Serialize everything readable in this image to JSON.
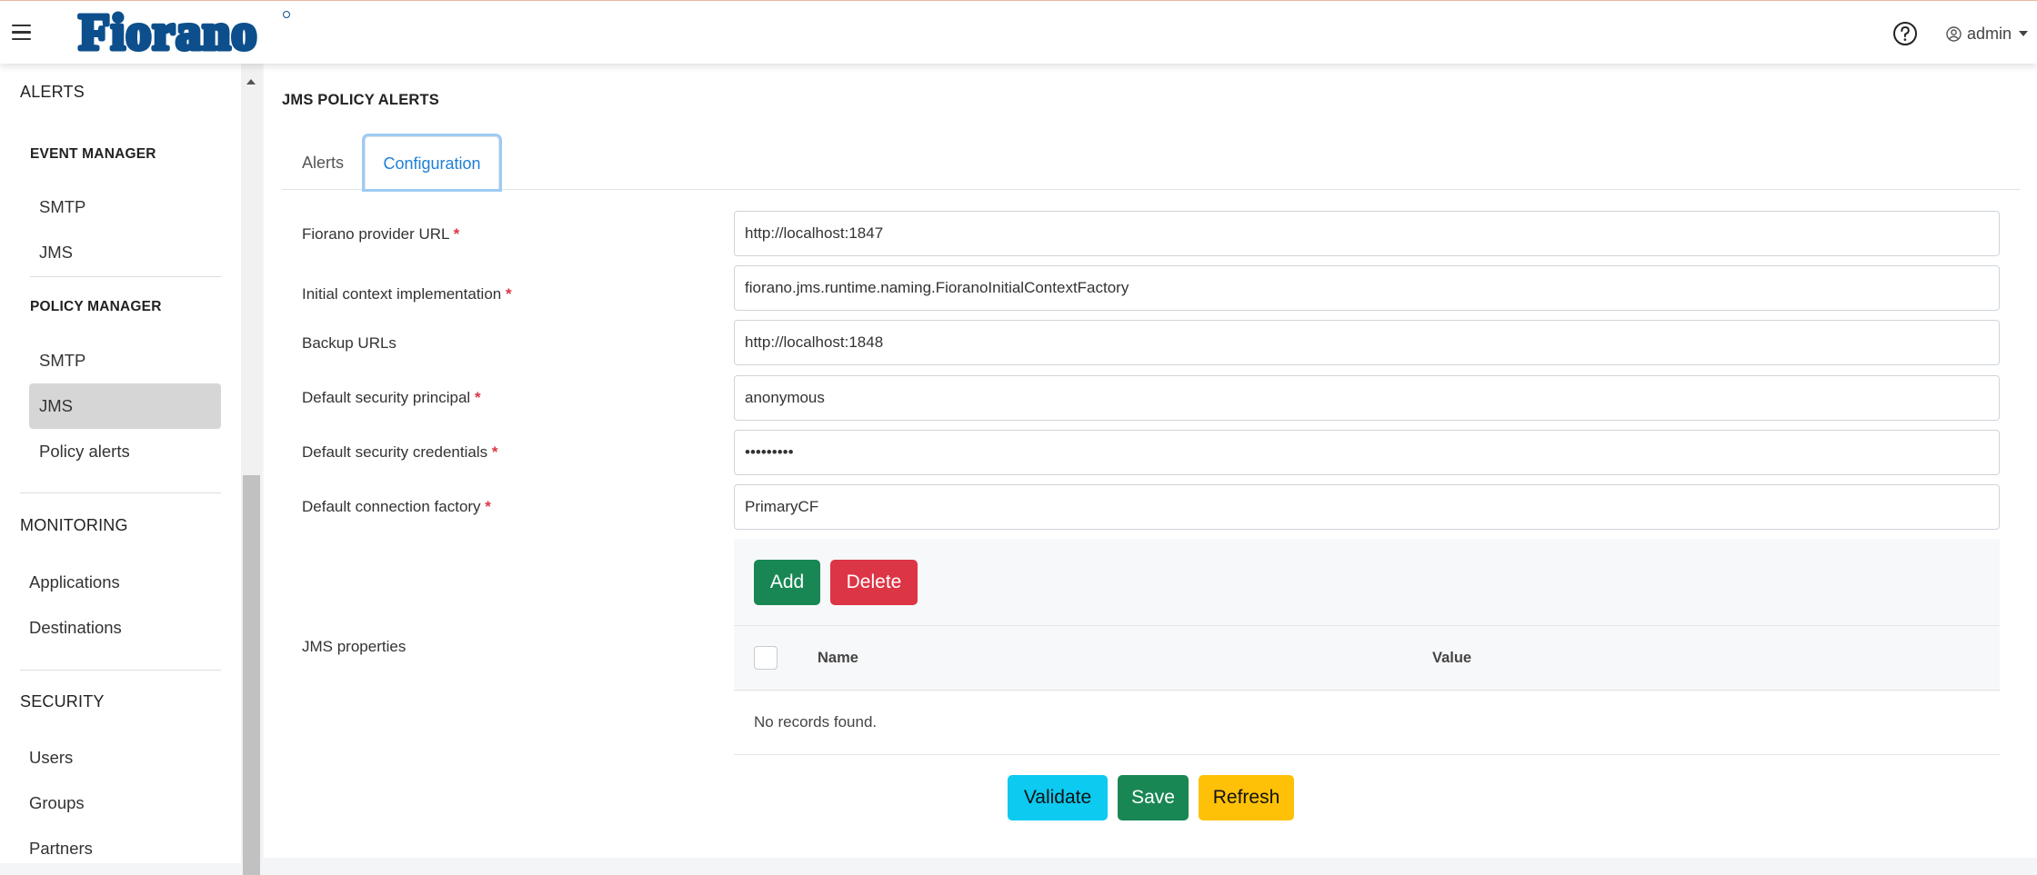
{
  "header": {
    "logo_text": "Fiorano",
    "user_label": "admin",
    "icons": {
      "menu": "hamburger-menu-icon",
      "help": "help-circle-icon",
      "user": "user-circle-icon"
    }
  },
  "sidebar": {
    "alerts_heading": "ALERTS",
    "event_manager_heading": "EVENT MANAGER",
    "event_manager_items": [
      "SMTP",
      "JMS"
    ],
    "policy_manager_heading": "POLICY MANAGER",
    "policy_manager_items": [
      "SMTP",
      "JMS",
      "Policy alerts"
    ],
    "active_item": "JMS",
    "monitoring_heading": "MONITORING",
    "monitoring_items": [
      "Applications",
      "Destinations"
    ],
    "security_heading": "SECURITY",
    "security_items": [
      "Users",
      "Groups",
      "Partners"
    ]
  },
  "main": {
    "title": "JMS POLICY ALERTS",
    "tabs": [
      {
        "label": "Alerts",
        "active": false
      },
      {
        "label": "Configuration",
        "active": true
      }
    ],
    "form": {
      "provider_url": {
        "label": "Fiorano provider URL",
        "required": "*",
        "value": "http://localhost:1847"
      },
      "initial_context": {
        "label": "Initial context implementation",
        "required": "*",
        "value": "fiorano.jms.runtime.naming.FioranoInitialContextFactory"
      },
      "backup_urls": {
        "label": "Backup URLs",
        "value": "http://localhost:1848"
      },
      "security_principal": {
        "label": "Default security principal",
        "required": "*",
        "value": "anonymous"
      },
      "security_credentials": {
        "label": "Default security credentials",
        "required": "*",
        "value": "•••••••••"
      },
      "connection_factory": {
        "label": "Default connection factory",
        "required": "*",
        "value": "PrimaryCF"
      }
    },
    "jms_properties": {
      "label": "JMS properties",
      "add_label": "Add",
      "delete_label": "Delete",
      "columns": [
        "Name",
        "Value"
      ],
      "empty_message": "No records found."
    },
    "actions": {
      "validate": "Validate",
      "save": "Save",
      "refresh": "Refresh"
    }
  },
  "colors": {
    "accent_blue": "#1f7fd6",
    "success": "#198754",
    "danger": "#dc3545",
    "info": "#0dcaf0",
    "warning": "#ffc107",
    "logo_blue": "#0d4f8c"
  }
}
